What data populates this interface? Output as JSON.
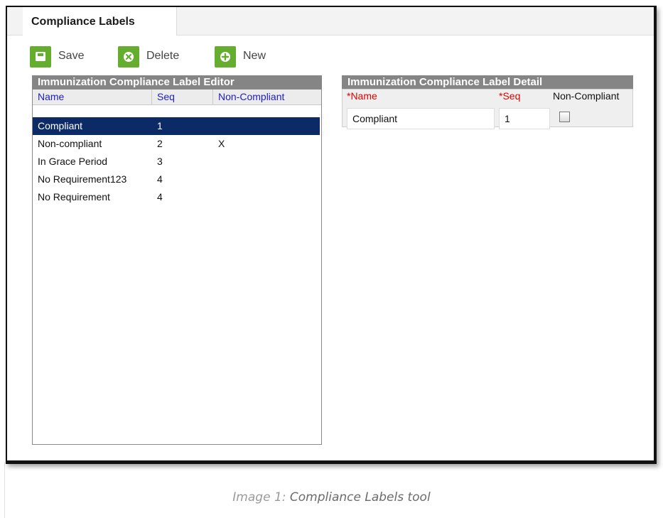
{
  "tab": {
    "title": "Compliance Labels"
  },
  "toolbar": {
    "save_label": "Save",
    "delete_label": "Delete",
    "new_label": "New"
  },
  "editor": {
    "title": "Immunization Compliance Label Editor",
    "columns": [
      "Name",
      "Seq",
      "Non-Compliant"
    ],
    "rows": [
      {
        "name": "Compliant",
        "seq": "1",
        "noncompliant": "",
        "selected": true
      },
      {
        "name": "Non-compliant",
        "seq": "2",
        "noncompliant": "X",
        "selected": false
      },
      {
        "name": "In Grace Period",
        "seq": "3",
        "noncompliant": "",
        "selected": false
      },
      {
        "name": "No Requirement123",
        "seq": "4",
        "noncompliant": "",
        "selected": false
      },
      {
        "name": "No Requirement",
        "seq": "4",
        "noncompliant": "",
        "selected": false
      }
    ]
  },
  "detail": {
    "title": "Immunization Compliance Label Detail",
    "name_label": "*Name",
    "seq_label": "*Seq",
    "noncompliant_label": "Non-Compliant",
    "name_value": "Compliant",
    "seq_value": "1",
    "noncompliant_checked": false
  },
  "caption": {
    "prefix": "Image 1: ",
    "text": "Compliance Labels tool"
  },
  "colors": {
    "accent_green": "#65ad2e",
    "selection": "#0c2a66",
    "header_gray": "#858585",
    "required_red": "#e00000",
    "column_link": "#2020c0"
  }
}
